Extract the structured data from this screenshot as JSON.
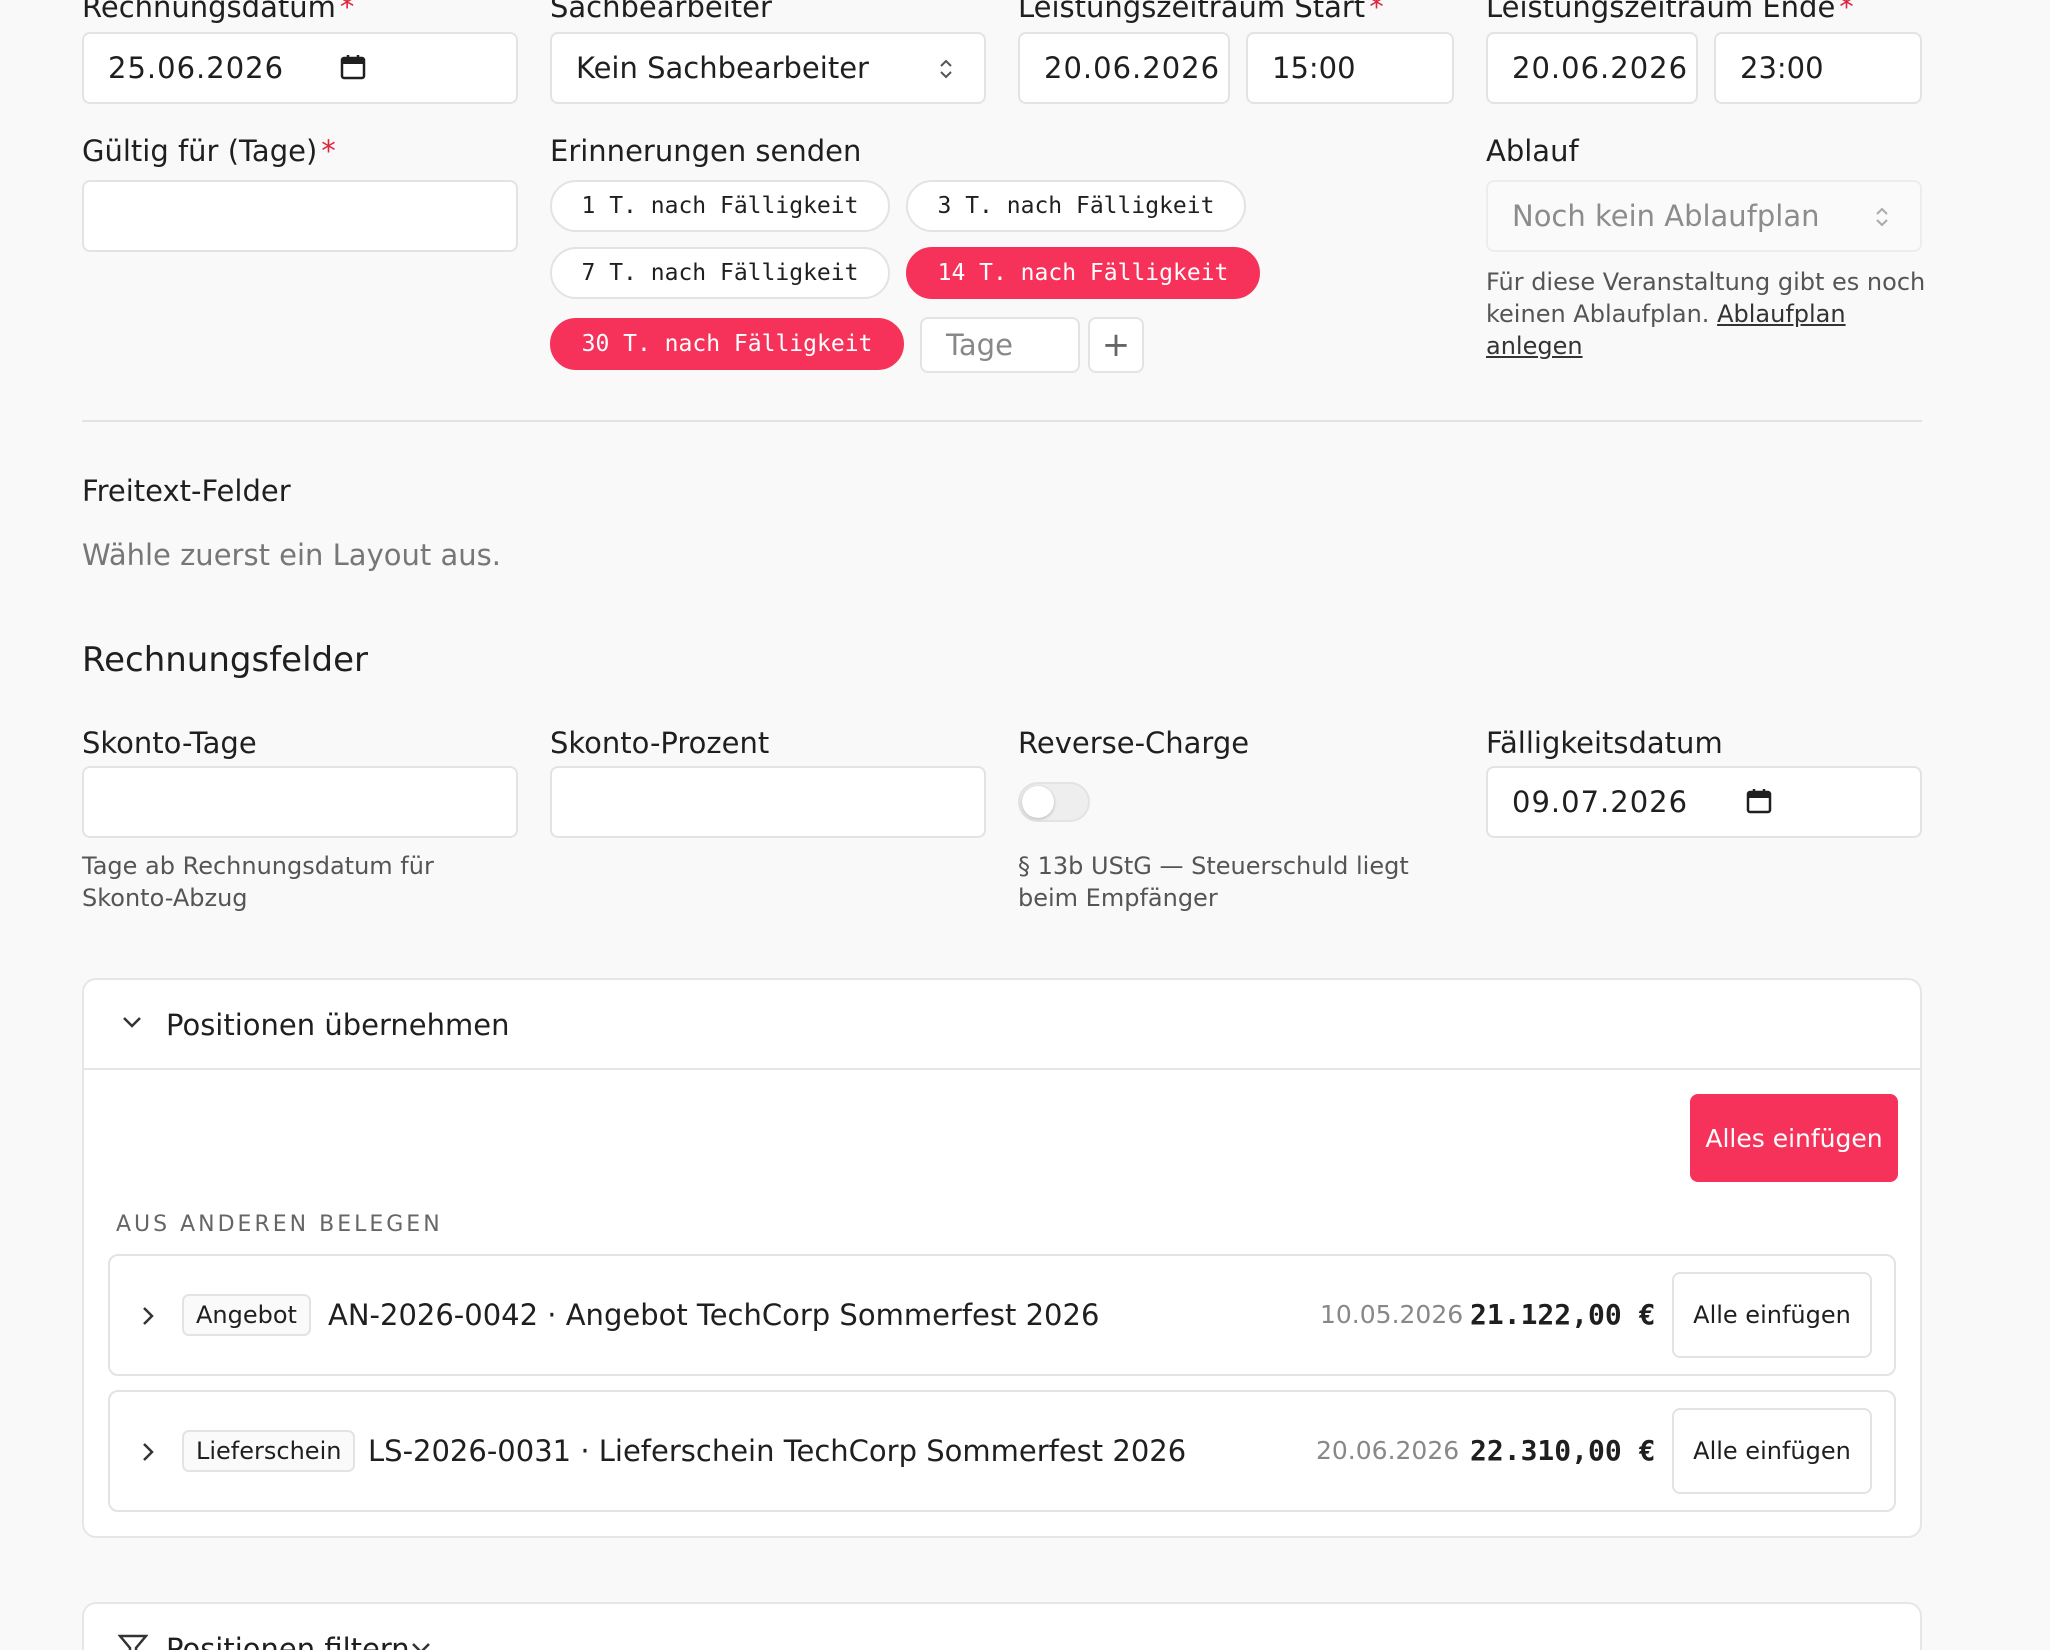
{
  "top": {
    "invoice_date": {
      "label": "Rechnungsdatum",
      "value": "25.06.2026"
    },
    "clerk": {
      "label": "Sachbearbeiter",
      "value": "Kein Sachbearbeiter"
    },
    "period_start": {
      "label": "Leistungszeitraum Start",
      "date": "20.06.2026",
      "time": "15:00"
    },
    "period_end": {
      "label": "Leistungszeitraum Ende",
      "date": "20.06.2026",
      "time": "23:00"
    },
    "required_mark": "*"
  },
  "valid_days": {
    "label": "Gültig für (Tage)",
    "value": ""
  },
  "reminders": {
    "label": "Erinnerungen senden",
    "chips": [
      {
        "label": "1 T. nach Fälligkeit",
        "active": false
      },
      {
        "label": "3 T. nach Fälligkeit",
        "active": false
      },
      {
        "label": "7 T. nach Fälligkeit",
        "active": false
      },
      {
        "label": "14 T. nach Fälligkeit",
        "active": true
      },
      {
        "label": "30 T. nach Fälligkeit",
        "active": true
      }
    ],
    "days_placeholder": "Tage",
    "add_symbol": "+"
  },
  "flow": {
    "label": "Ablauf",
    "placeholder": "Noch kein Ablaufplan",
    "hint": "Für diese Veranstaltung gibt es noch keinen Ablaufplan.",
    "hint_link": "Ablaufplan anlegen"
  },
  "freetext": {
    "title": "Freitext-Felder",
    "hint": "Wähle zuerst ein Layout aus."
  },
  "invoice_fields": {
    "title": "Rechnungsfelder",
    "skonto_days": {
      "label": "Skonto-Tage",
      "value": "",
      "hint": "Tage ab Rechnungsdatum für Skonto-Abzug"
    },
    "skonto_percent": {
      "label": "Skonto-Prozent",
      "value": ""
    },
    "reverse_charge": {
      "label": "Reverse-Charge",
      "enabled": false,
      "hint": "§ 13b UStG — Steuerschuld liegt beim Empfänger"
    },
    "due_date": {
      "label": "Fälligkeitsdatum",
      "value": "09.07.2026"
    }
  },
  "positions": {
    "title": "Positionen übernehmen",
    "insert_all_label": "Alles einfügen",
    "from_other_label": "AUS ANDEREN BELEGEN",
    "docs": [
      {
        "type": "Angebot",
        "title": "AN-2026-0042 · Angebot TechCorp Sommerfest 2026",
        "date": "10.05.2026",
        "amount": "21.122,00 €",
        "button": "Alle einfügen"
      },
      {
        "type": "Lieferschein",
        "title": "LS-2026-0031 · Lieferschein TechCorp Sommerfest 2026",
        "date": "20.06.2026",
        "amount": "22.310,00 €",
        "button": "Alle einfügen"
      }
    ]
  },
  "filter": {
    "title": "Positionen filtern"
  },
  "colors": {
    "accent": "#f7325a",
    "required": "#e0243d",
    "border": "#e3e3e3"
  }
}
